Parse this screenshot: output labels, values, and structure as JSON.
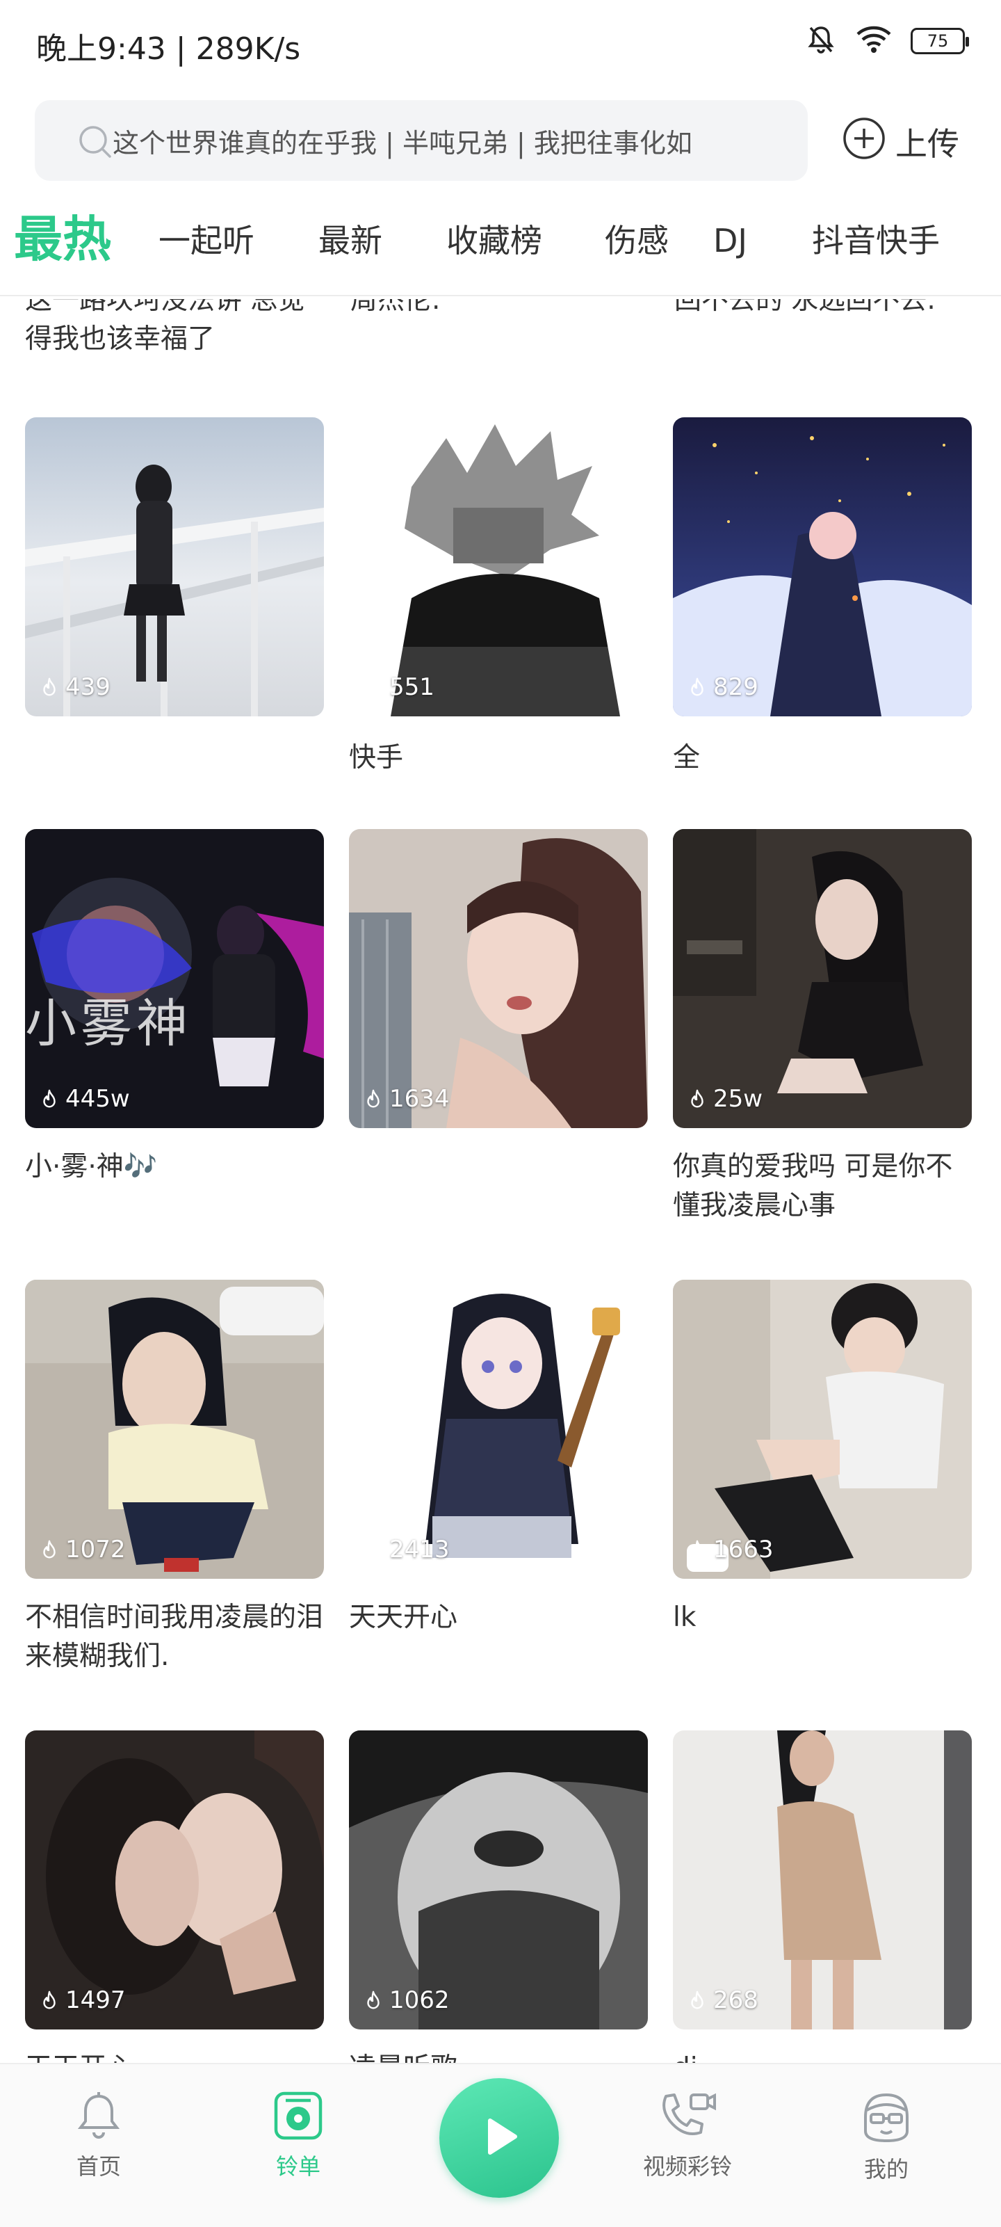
{
  "status_bar": {
    "time": "晚上9:43 | 289K/s",
    "battery": "75"
  },
  "search": {
    "query": "这个世界谁真的在乎我 | 半吨兄弟 | 我把往事化如"
  },
  "upload": {
    "label": "上传"
  },
  "tabs": [
    {
      "label": "最热",
      "active": true
    },
    {
      "label": "一起听"
    },
    {
      "label": "最新"
    },
    {
      "label": "收藏榜"
    },
    {
      "label": "伤感"
    },
    {
      "label": "DJ"
    },
    {
      "label": "抖音快手"
    }
  ],
  "top_partial_captions": [
    "这一路坎坷没法讲 总觉得我也该幸福了",
    "周杰伦.",
    "回不去的 永远回不去."
  ],
  "playlists": [
    {
      "plays": "439",
      "title": ""
    },
    {
      "plays": "551",
      "title": "快手"
    },
    {
      "plays": "829",
      "title": "全"
    },
    {
      "plays": "445w",
      "title": "小·雾·神🎶"
    },
    {
      "plays": "1634",
      "title": ""
    },
    {
      "plays": "25w",
      "title": "你真的爱我吗  可是你不懂我凌晨心事"
    },
    {
      "plays": "1072",
      "title": "不相信时间我用凌晨的泪来模糊我们."
    },
    {
      "plays": "2413",
      "title": "天天开心"
    },
    {
      "plays": "1663",
      "title": "lk"
    },
    {
      "plays": "1497",
      "title": "天天开心"
    },
    {
      "plays": "1062",
      "title": "凌晨听歌"
    },
    {
      "plays": "268",
      "title": "dj"
    }
  ],
  "thumb_overlay": {
    "text": "小雾神"
  },
  "bottom_nav": {
    "home": "首页",
    "playlist": "铃单",
    "video_ringtone": "视频彩铃",
    "mine": "我的"
  },
  "colors": {
    "accent": "#2cc98a",
    "text": "#333333"
  }
}
